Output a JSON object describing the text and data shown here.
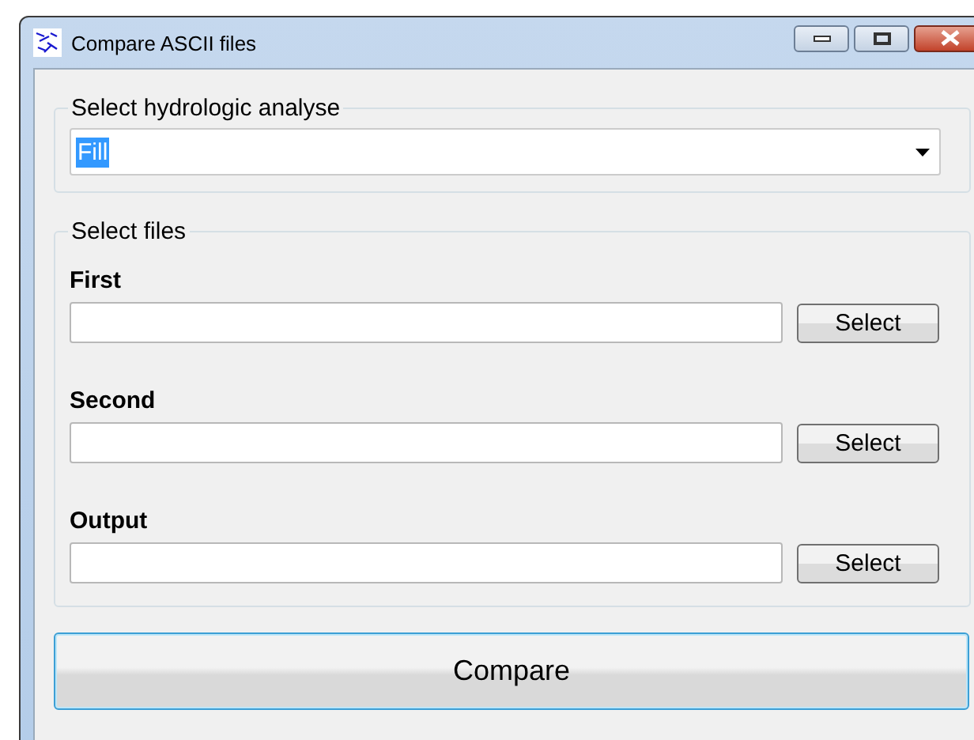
{
  "window": {
    "title": "Compare ASCII files"
  },
  "analysis_group": {
    "title": "Select hydrologic analyse",
    "value": "Fill",
    "text_selected": true
  },
  "files_group": {
    "title": "Select files",
    "fields": [
      {
        "label": "First",
        "button": "Select"
      },
      {
        "label": "Second",
        "button": "Select"
      },
      {
        "label": "Output",
        "button": "Select"
      }
    ]
  },
  "compare_button": "Compare"
}
